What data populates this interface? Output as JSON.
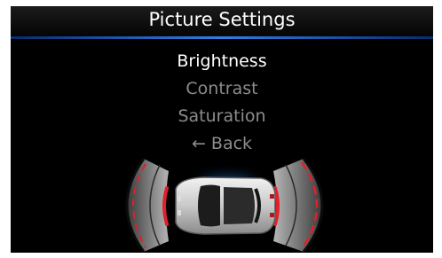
{
  "header": {
    "title": "Picture Settings"
  },
  "menu": {
    "items": [
      {
        "label": "Brightness",
        "selected": true
      },
      {
        "label": "Contrast",
        "selected": false
      },
      {
        "label": "Saturation",
        "selected": false
      },
      {
        "label": "← Back",
        "selected": false
      }
    ]
  },
  "colors": {
    "accent": "#2f7fe6",
    "selected_text": "#ffffff",
    "dim_text": "#8c8c8c",
    "sensor_alert": "#e0202a"
  },
  "icons": {
    "car": "car-top-view-icon",
    "sensors": "parking-sensor-zone-icon"
  }
}
